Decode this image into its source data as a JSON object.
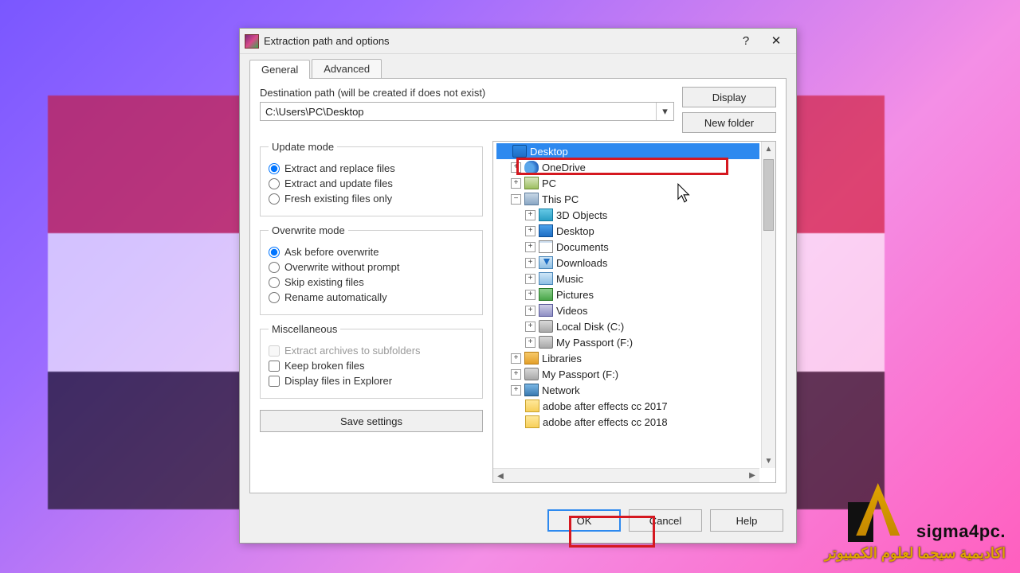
{
  "window": {
    "title": "Extraction path and options"
  },
  "tabs": {
    "general": "General",
    "advanced": "Advanced"
  },
  "dest": {
    "label": "Destination path (will be created if does not exist)",
    "value": "C:\\Users\\PC\\Desktop"
  },
  "buttons": {
    "display": "Display",
    "newfolder": "New folder",
    "savesettings": "Save settings",
    "ok": "OK",
    "cancel": "Cancel",
    "help": "Help"
  },
  "groups": {
    "update": {
      "legend": "Update mode",
      "opt1": "Extract and replace files",
      "opt2": "Extract and update files",
      "opt3": "Fresh existing files only"
    },
    "overwrite": {
      "legend": "Overwrite mode",
      "opt1": "Ask before overwrite",
      "opt2": "Overwrite without prompt",
      "opt3": "Skip existing files",
      "opt4": "Rename automatically"
    },
    "misc": {
      "legend": "Miscellaneous",
      "chk1": "Extract archives to subfolders",
      "chk2": "Keep broken files",
      "chk3": "Display files in Explorer"
    }
  },
  "tree": {
    "n0": "Desktop",
    "n1": "OneDrive",
    "n2": "PC",
    "n3": "This PC",
    "n4": "3D Objects",
    "n5": "Desktop",
    "n6": "Documents",
    "n7": "Downloads",
    "n8": "Music",
    "n9": "Pictures",
    "n10": "Videos",
    "n11": "Local Disk (C:)",
    "n12": "My Passport (F:)",
    "n13": "Libraries",
    "n14": "My Passport (F:)",
    "n15": "Network",
    "n16": "adobe after effects cc 2017",
    "n17": "adobe after effects cc 2018"
  },
  "watermark": {
    "brand": "sigma4pc.",
    "sub": "اكاديمية سيجما لعلوم الكمبيوتر"
  }
}
